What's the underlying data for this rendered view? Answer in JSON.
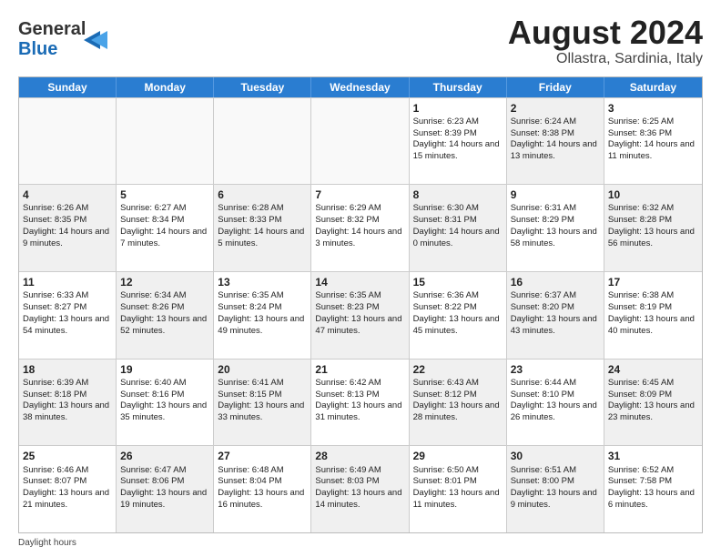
{
  "header": {
    "logo_line1": "General",
    "logo_line2": "Blue",
    "title": "August 2024",
    "location": "Ollastra, Sardinia, Italy"
  },
  "weekdays": [
    "Sunday",
    "Monday",
    "Tuesday",
    "Wednesday",
    "Thursday",
    "Friday",
    "Saturday"
  ],
  "weeks": [
    [
      {
        "day": "",
        "sunrise": "",
        "sunset": "",
        "daylight": "",
        "shaded": false,
        "empty": true
      },
      {
        "day": "",
        "sunrise": "",
        "sunset": "",
        "daylight": "",
        "shaded": false,
        "empty": true
      },
      {
        "day": "",
        "sunrise": "",
        "sunset": "",
        "daylight": "",
        "shaded": false,
        "empty": true
      },
      {
        "day": "",
        "sunrise": "",
        "sunset": "",
        "daylight": "",
        "shaded": false,
        "empty": true
      },
      {
        "day": "1",
        "sunrise": "Sunrise: 6:23 AM",
        "sunset": "Sunset: 8:39 PM",
        "daylight": "Daylight: 14 hours and 15 minutes.",
        "shaded": false,
        "empty": false
      },
      {
        "day": "2",
        "sunrise": "Sunrise: 6:24 AM",
        "sunset": "Sunset: 8:38 PM",
        "daylight": "Daylight: 14 hours and 13 minutes.",
        "shaded": true,
        "empty": false
      },
      {
        "day": "3",
        "sunrise": "Sunrise: 6:25 AM",
        "sunset": "Sunset: 8:36 PM",
        "daylight": "Daylight: 14 hours and 11 minutes.",
        "shaded": false,
        "empty": false
      }
    ],
    [
      {
        "day": "4",
        "sunrise": "Sunrise: 6:26 AM",
        "sunset": "Sunset: 8:35 PM",
        "daylight": "Daylight: 14 hours and 9 minutes.",
        "shaded": true,
        "empty": false
      },
      {
        "day": "5",
        "sunrise": "Sunrise: 6:27 AM",
        "sunset": "Sunset: 8:34 PM",
        "daylight": "Daylight: 14 hours and 7 minutes.",
        "shaded": false,
        "empty": false
      },
      {
        "day": "6",
        "sunrise": "Sunrise: 6:28 AM",
        "sunset": "Sunset: 8:33 PM",
        "daylight": "Daylight: 14 hours and 5 minutes.",
        "shaded": true,
        "empty": false
      },
      {
        "day": "7",
        "sunrise": "Sunrise: 6:29 AM",
        "sunset": "Sunset: 8:32 PM",
        "daylight": "Daylight: 14 hours and 3 minutes.",
        "shaded": false,
        "empty": false
      },
      {
        "day": "8",
        "sunrise": "Sunrise: 6:30 AM",
        "sunset": "Sunset: 8:31 PM",
        "daylight": "Daylight: 14 hours and 0 minutes.",
        "shaded": true,
        "empty": false
      },
      {
        "day": "9",
        "sunrise": "Sunrise: 6:31 AM",
        "sunset": "Sunset: 8:29 PM",
        "daylight": "Daylight: 13 hours and 58 minutes.",
        "shaded": false,
        "empty": false
      },
      {
        "day": "10",
        "sunrise": "Sunrise: 6:32 AM",
        "sunset": "Sunset: 8:28 PM",
        "daylight": "Daylight: 13 hours and 56 minutes.",
        "shaded": true,
        "empty": false
      }
    ],
    [
      {
        "day": "11",
        "sunrise": "Sunrise: 6:33 AM",
        "sunset": "Sunset: 8:27 PM",
        "daylight": "Daylight: 13 hours and 54 minutes.",
        "shaded": false,
        "empty": false
      },
      {
        "day": "12",
        "sunrise": "Sunrise: 6:34 AM",
        "sunset": "Sunset: 8:26 PM",
        "daylight": "Daylight: 13 hours and 52 minutes.",
        "shaded": true,
        "empty": false
      },
      {
        "day": "13",
        "sunrise": "Sunrise: 6:35 AM",
        "sunset": "Sunset: 8:24 PM",
        "daylight": "Daylight: 13 hours and 49 minutes.",
        "shaded": false,
        "empty": false
      },
      {
        "day": "14",
        "sunrise": "Sunrise: 6:35 AM",
        "sunset": "Sunset: 8:23 PM",
        "daylight": "Daylight: 13 hours and 47 minutes.",
        "shaded": true,
        "empty": false
      },
      {
        "day": "15",
        "sunrise": "Sunrise: 6:36 AM",
        "sunset": "Sunset: 8:22 PM",
        "daylight": "Daylight: 13 hours and 45 minutes.",
        "shaded": false,
        "empty": false
      },
      {
        "day": "16",
        "sunrise": "Sunrise: 6:37 AM",
        "sunset": "Sunset: 8:20 PM",
        "daylight": "Daylight: 13 hours and 43 minutes.",
        "shaded": true,
        "empty": false
      },
      {
        "day": "17",
        "sunrise": "Sunrise: 6:38 AM",
        "sunset": "Sunset: 8:19 PM",
        "daylight": "Daylight: 13 hours and 40 minutes.",
        "shaded": false,
        "empty": false
      }
    ],
    [
      {
        "day": "18",
        "sunrise": "Sunrise: 6:39 AM",
        "sunset": "Sunset: 8:18 PM",
        "daylight": "Daylight: 13 hours and 38 minutes.",
        "shaded": true,
        "empty": false
      },
      {
        "day": "19",
        "sunrise": "Sunrise: 6:40 AM",
        "sunset": "Sunset: 8:16 PM",
        "daylight": "Daylight: 13 hours and 35 minutes.",
        "shaded": false,
        "empty": false
      },
      {
        "day": "20",
        "sunrise": "Sunrise: 6:41 AM",
        "sunset": "Sunset: 8:15 PM",
        "daylight": "Daylight: 13 hours and 33 minutes.",
        "shaded": true,
        "empty": false
      },
      {
        "day": "21",
        "sunrise": "Sunrise: 6:42 AM",
        "sunset": "Sunset: 8:13 PM",
        "daylight": "Daylight: 13 hours and 31 minutes.",
        "shaded": false,
        "empty": false
      },
      {
        "day": "22",
        "sunrise": "Sunrise: 6:43 AM",
        "sunset": "Sunset: 8:12 PM",
        "daylight": "Daylight: 13 hours and 28 minutes.",
        "shaded": true,
        "empty": false
      },
      {
        "day": "23",
        "sunrise": "Sunrise: 6:44 AM",
        "sunset": "Sunset: 8:10 PM",
        "daylight": "Daylight: 13 hours and 26 minutes.",
        "shaded": false,
        "empty": false
      },
      {
        "day": "24",
        "sunrise": "Sunrise: 6:45 AM",
        "sunset": "Sunset: 8:09 PM",
        "daylight": "Daylight: 13 hours and 23 minutes.",
        "shaded": true,
        "empty": false
      }
    ],
    [
      {
        "day": "25",
        "sunrise": "Sunrise: 6:46 AM",
        "sunset": "Sunset: 8:07 PM",
        "daylight": "Daylight: 13 hours and 21 minutes.",
        "shaded": false,
        "empty": false
      },
      {
        "day": "26",
        "sunrise": "Sunrise: 6:47 AM",
        "sunset": "Sunset: 8:06 PM",
        "daylight": "Daylight: 13 hours and 19 minutes.",
        "shaded": true,
        "empty": false
      },
      {
        "day": "27",
        "sunrise": "Sunrise: 6:48 AM",
        "sunset": "Sunset: 8:04 PM",
        "daylight": "Daylight: 13 hours and 16 minutes.",
        "shaded": false,
        "empty": false
      },
      {
        "day": "28",
        "sunrise": "Sunrise: 6:49 AM",
        "sunset": "Sunset: 8:03 PM",
        "daylight": "Daylight: 13 hours and 14 minutes.",
        "shaded": true,
        "empty": false
      },
      {
        "day": "29",
        "sunrise": "Sunrise: 6:50 AM",
        "sunset": "Sunset: 8:01 PM",
        "daylight": "Daylight: 13 hours and 11 minutes.",
        "shaded": false,
        "empty": false
      },
      {
        "day": "30",
        "sunrise": "Sunrise: 6:51 AM",
        "sunset": "Sunset: 8:00 PM",
        "daylight": "Daylight: 13 hours and 9 minutes.",
        "shaded": true,
        "empty": false
      },
      {
        "day": "31",
        "sunrise": "Sunrise: 6:52 AM",
        "sunset": "Sunset: 7:58 PM",
        "daylight": "Daylight: 13 hours and 6 minutes.",
        "shaded": false,
        "empty": false
      }
    ]
  ],
  "footer": "Daylight hours"
}
